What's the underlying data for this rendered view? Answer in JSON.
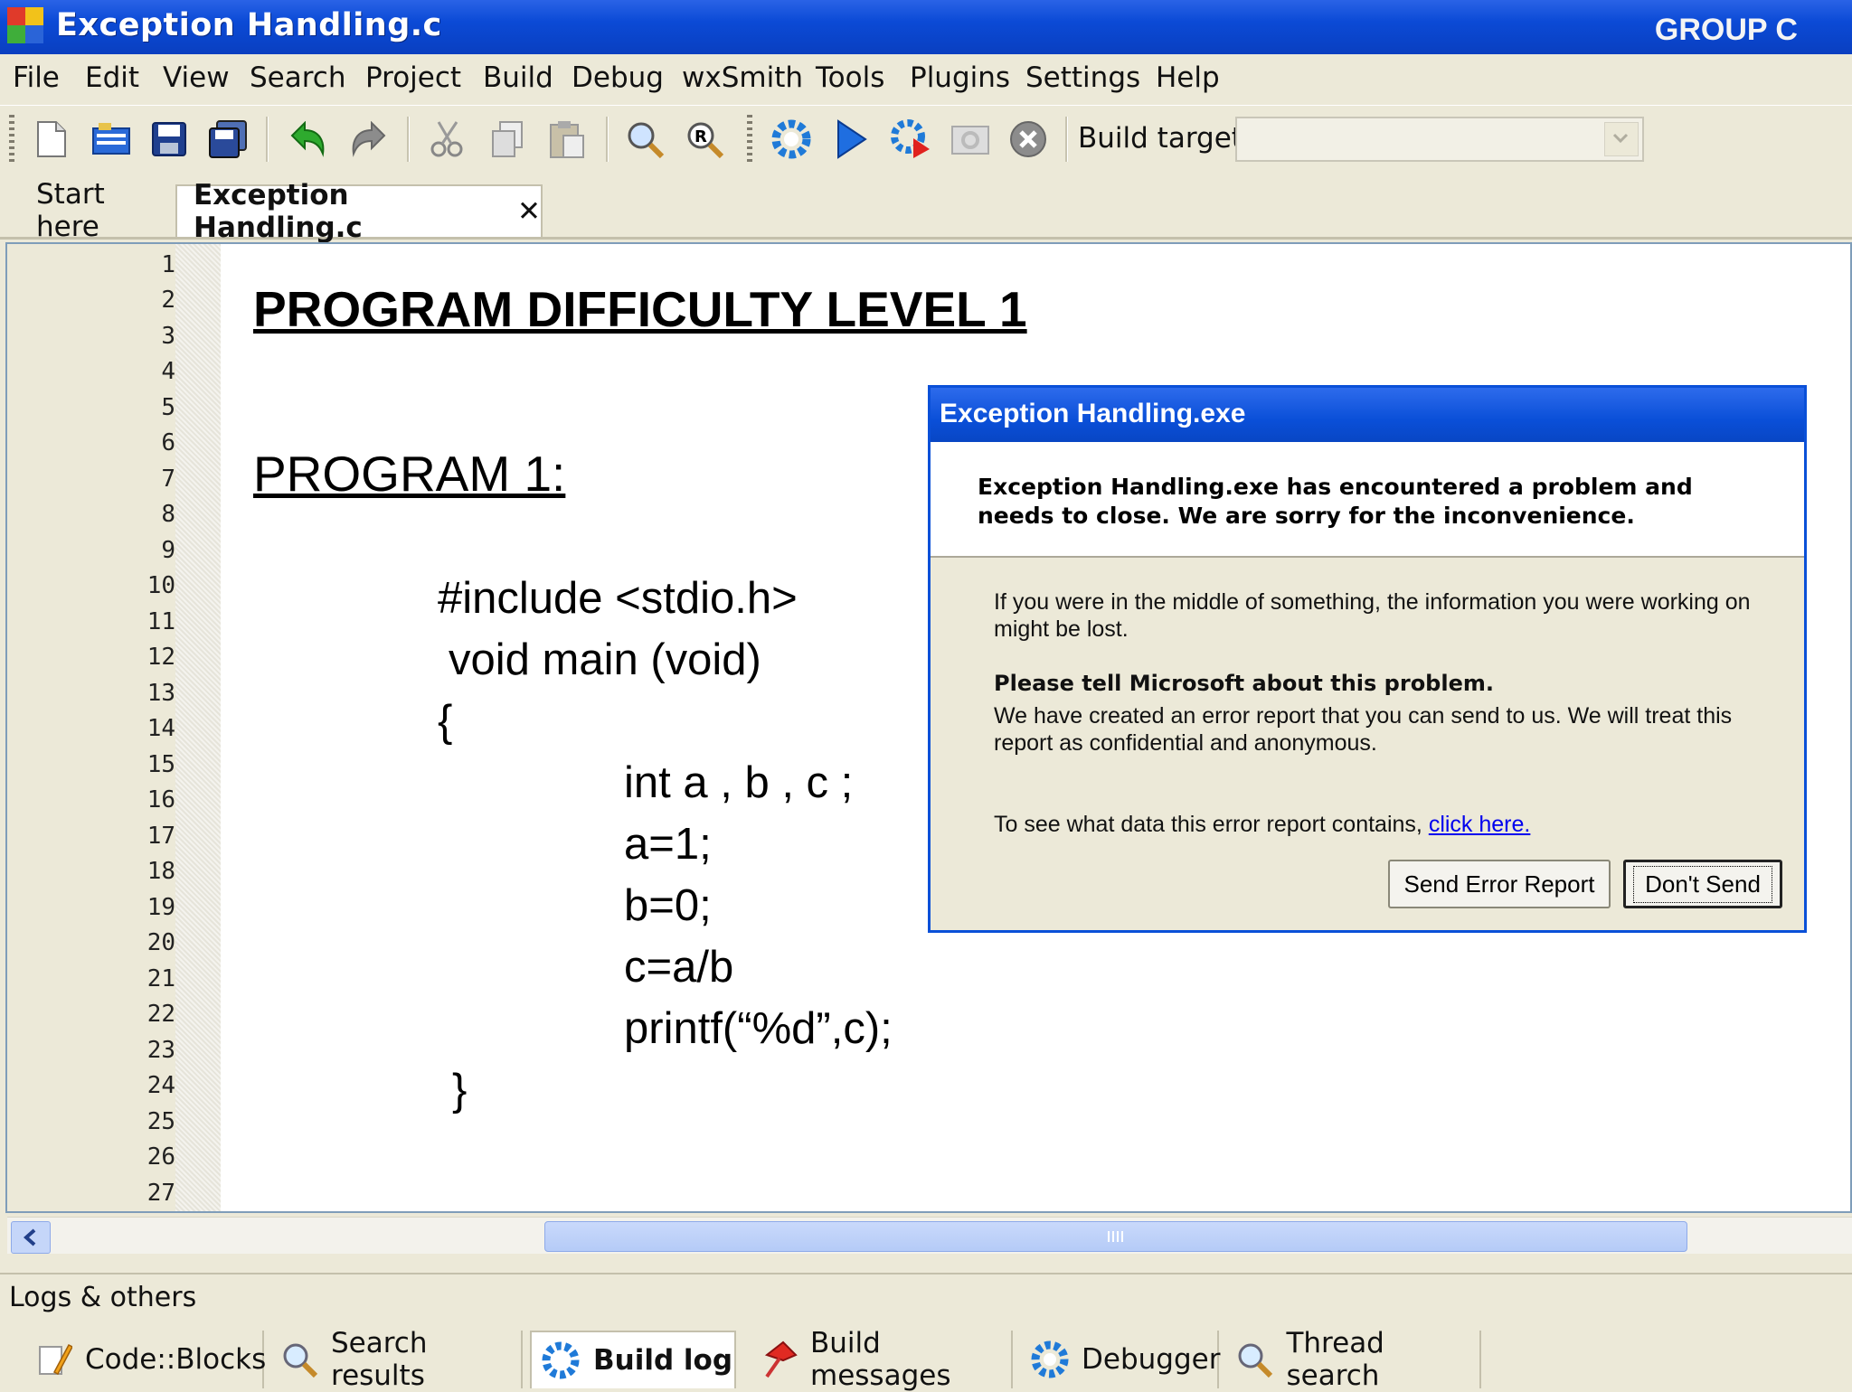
{
  "window": {
    "title": "Exception Handling.c",
    "watermark": "GROUP C"
  },
  "menu": [
    "File",
    "Edit",
    "View",
    "Search",
    "Project",
    "Build",
    "Debug",
    "wxSmith",
    "Tools",
    "Plugins",
    "Settings",
    "Help"
  ],
  "toolbar": {
    "build_target_label": "Build target:",
    "build_target_value": "",
    "icons": [
      "new-file-icon",
      "open-icon",
      "save-icon",
      "save-all-icon",
      "undo-icon",
      "redo-icon",
      "cut-icon",
      "copy-icon",
      "paste-icon",
      "find-icon",
      "replace-icon",
      "build-icon",
      "run-icon",
      "build-and-run-icon",
      "rebuild-icon",
      "abort-icon"
    ]
  },
  "editor_tabs": [
    {
      "label": "Start here",
      "active": false
    },
    {
      "label": "Exception Handling.c",
      "active": true,
      "close": "✕"
    }
  ],
  "editor": {
    "line_numbers": [
      "1",
      "2",
      "3",
      "4",
      "5",
      "6",
      "7",
      "8",
      "9",
      "10",
      "11",
      "12",
      "13",
      "14",
      "15",
      "16",
      "17",
      "18",
      "19",
      "20",
      "21",
      "22",
      "23",
      "24",
      "25",
      "26",
      "27"
    ],
    "heading": "PROGRAM DIFFICULTY LEVEL 1",
    "program_label": "PROGRAM 1:",
    "code": [
      "#include <stdio.h>",
      "void main (void)",
      "{",
      "int a , b , c ;",
      "a=1;",
      "b=0;",
      "c=a/b",
      "printf(“%d”,c);",
      "}"
    ]
  },
  "logs": {
    "title": "Logs & others",
    "tabs": [
      {
        "label": "Code::Blocks",
        "icon": "pencil-icon",
        "active": false
      },
      {
        "label": "Search results",
        "icon": "magnifier-icon",
        "active": false
      },
      {
        "label": "Build log",
        "icon": "gear-icon",
        "active": true
      },
      {
        "label": "Build messages",
        "icon": "pin-icon",
        "active": false
      },
      {
        "label": "Debugger",
        "icon": "gear-icon",
        "active": false
      },
      {
        "label": "Thread search",
        "icon": "magnifier-icon",
        "active": false
      }
    ]
  },
  "dialog": {
    "title": "Exception Handling.exe",
    "headline": "Exception Handling.exe has encountered a problem and needs to close.  We are sorry for the inconvenience.",
    "info": "If you were in the middle of something, the information you were working on might be lost.",
    "tell_heading": "Please tell Microsoft about this problem.",
    "tell_body": "We have created an error report that you can send to us.  We will treat this report as confidential and anonymous.",
    "data_prefix": "To see what data this error report contains, ",
    "data_link": "click here.",
    "send_button": "Send Error Report",
    "dont_send_button": "Don't Send"
  }
}
